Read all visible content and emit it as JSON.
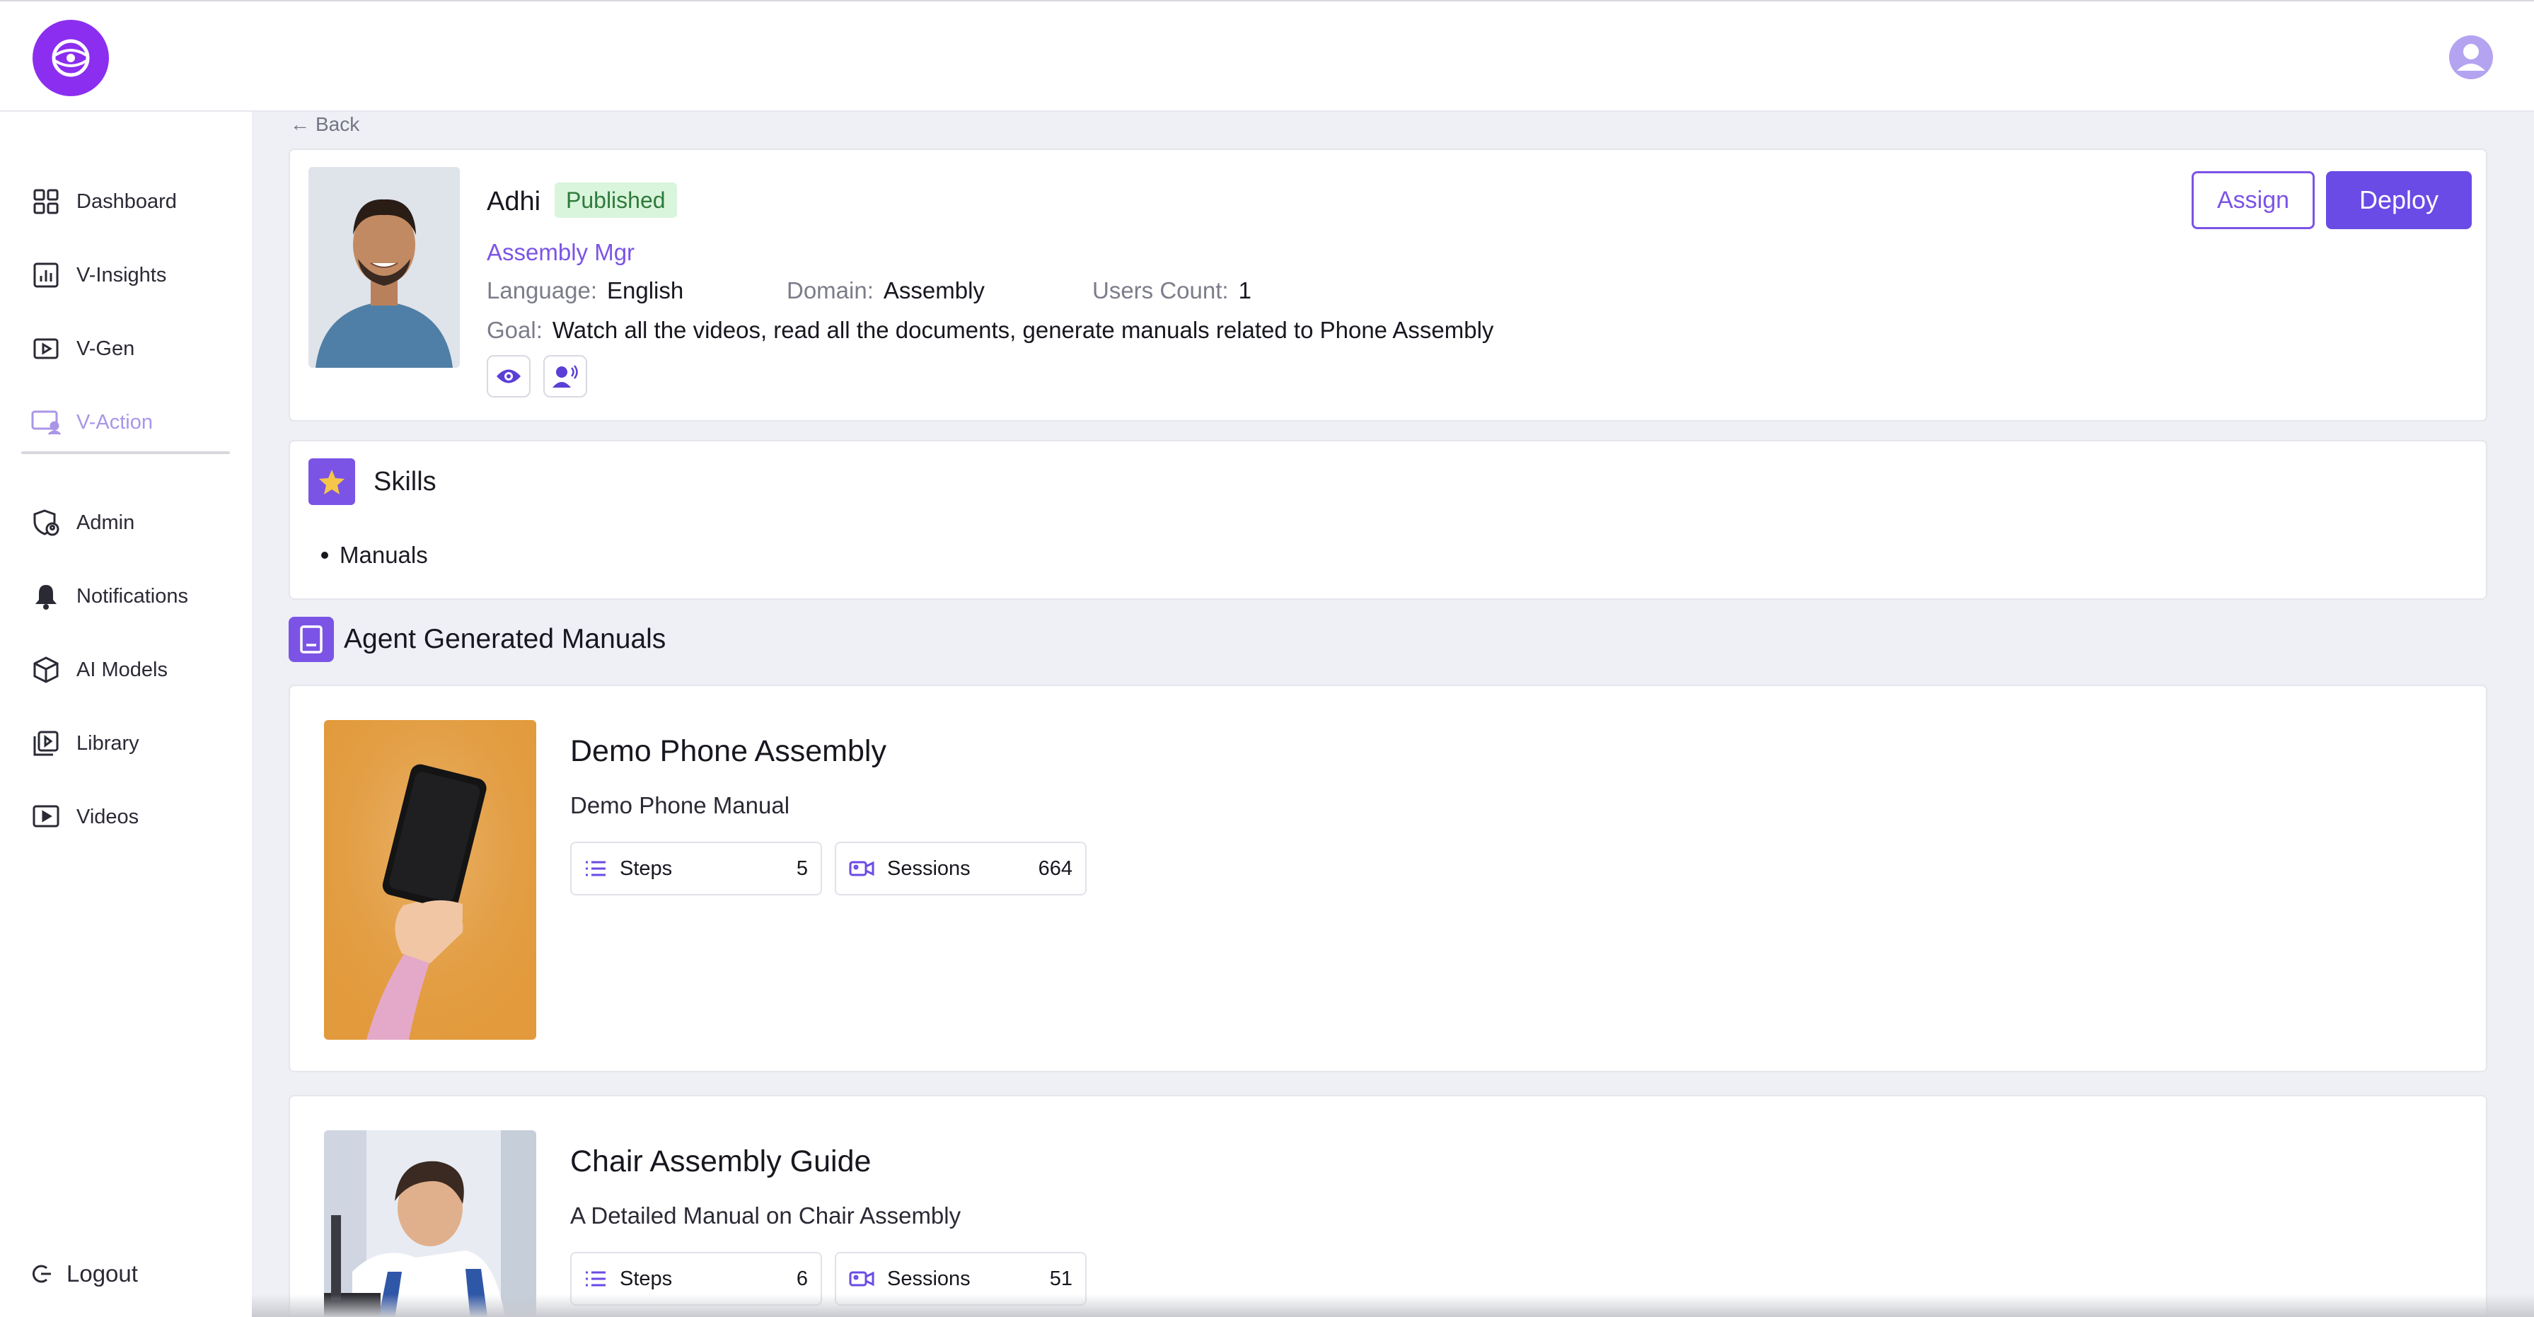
{
  "header": {
    "logo_icon": "globe-eye-icon",
    "avatar_icon": "user-circle-icon"
  },
  "sidebar": {
    "items": [
      {
        "label": "Dashboard",
        "icon": "grid-icon"
      },
      {
        "label": "V-Insights",
        "icon": "bar-chart-icon"
      },
      {
        "label": "V-Gen",
        "icon": "play-square-icon"
      },
      {
        "label": "V-Action",
        "icon": "screen-user-icon",
        "active": true
      },
      {
        "label": "Admin",
        "icon": "shield-user-icon"
      },
      {
        "label": "Notifications",
        "icon": "bell-icon"
      },
      {
        "label": "AI Models",
        "icon": "cube-icon"
      },
      {
        "label": "Library",
        "icon": "library-icon"
      },
      {
        "label": "Videos",
        "icon": "video-play-icon"
      }
    ],
    "logout_label": "Logout"
  },
  "back_label": "Back",
  "agent": {
    "name": "Adhi",
    "status": "Published",
    "role": "Assembly Mgr",
    "language_label": "Language:",
    "language": "English",
    "domain_label": "Domain:",
    "domain": "Assembly",
    "users_count_label": "Users Count:",
    "users_count": "1",
    "goal_label": "Goal:",
    "goal": "Watch all the videos, read all the documents, generate manuals related to Phone Assembly",
    "capability_icons": [
      "eye-icon",
      "voice-icon"
    ],
    "assign_label": "Assign",
    "deploy_label": "Deploy"
  },
  "skills": {
    "title": "Skills",
    "items": [
      "Manuals"
    ]
  },
  "manuals_section": {
    "title": "Agent Generated Manuals",
    "manuals": [
      {
        "title": "Demo Phone Assembly",
        "description": "Demo Phone Manual",
        "steps_label": "Steps",
        "steps": "5",
        "sessions_label": "Sessions",
        "sessions": "664"
      },
      {
        "title": "Chair Assembly Guide",
        "description": "A Detailed Manual on Chair Assembly",
        "steps_label": "Steps",
        "steps": "6",
        "sessions_label": "Sessions",
        "sessions": "51"
      }
    ]
  },
  "colors": {
    "accent": "#6a4be6",
    "logo": "#8b2ef0",
    "published_bg": "#d9f5dc",
    "published_text": "#2f7a3b"
  }
}
